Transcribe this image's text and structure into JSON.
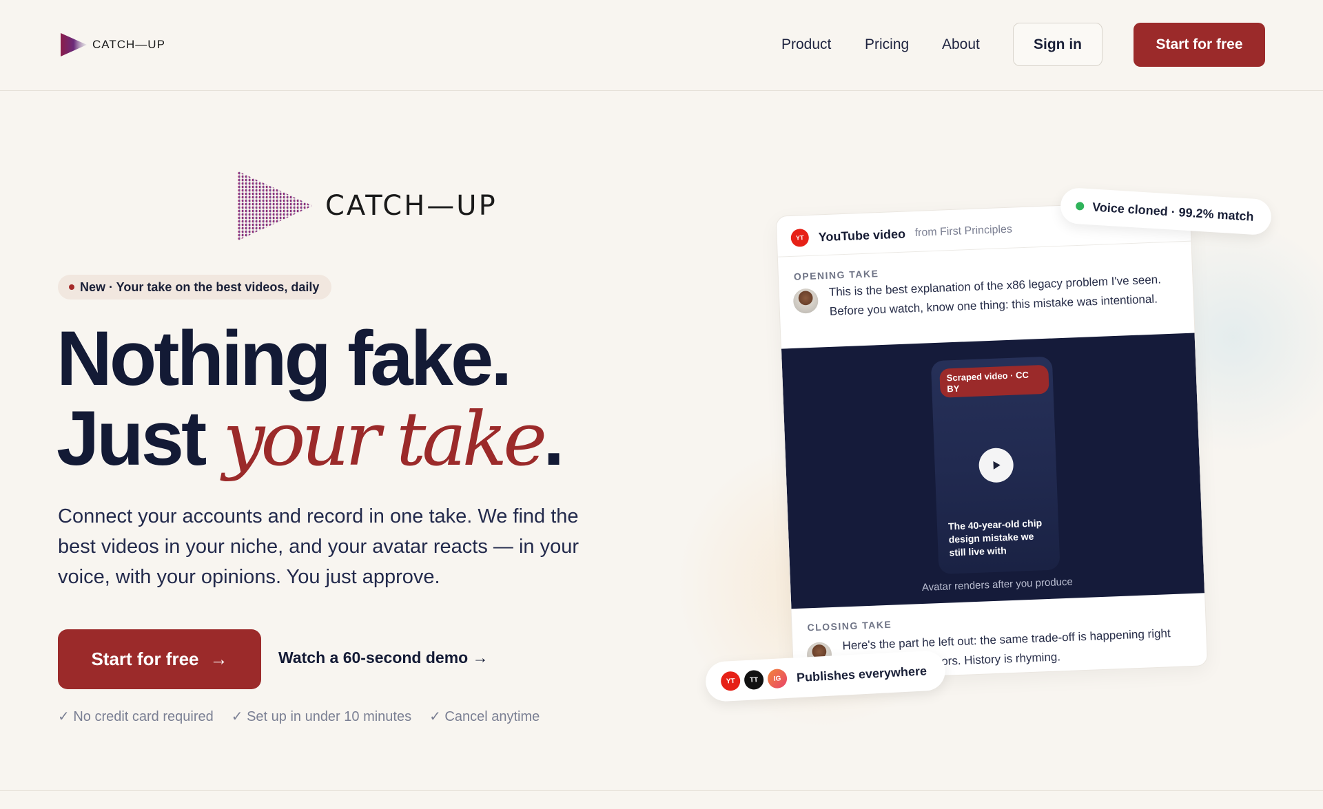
{
  "nav": {
    "brand": "CATCH—UP",
    "links": [
      "Product",
      "Pricing",
      "About"
    ],
    "signin_label": "Sign in",
    "start_label": "Start for free"
  },
  "hero": {
    "brand": "CATCH—UP",
    "pill_text": "New · Your take on the best videos, daily",
    "headline_line1": "Nothing fake.",
    "headline_just": "Just ",
    "headline_accent": "your take",
    "headline_end": ".",
    "subtitle": "Connect your accounts and record in one take. We find the best videos in your niche, and your avatar reacts — in your voice, with your opinions. You just approve.",
    "cta_label": "Start for free",
    "cta_arrow": "→",
    "demo_label": "Watch a 60-second demo →",
    "checks": [
      "✓ No credit card required",
      "✓ Set up in under 10 minutes",
      "✓ Cancel anytime"
    ]
  },
  "card": {
    "source_badge": "YT",
    "title": "YouTube video",
    "from": "from First Principles",
    "opening_label": "OPENING TAKE",
    "opening_text": "This is the best explanation of the x86 legacy problem I've seen. Before you watch, know one thing: this mistake was intentional.",
    "scraped_label": "Scraped video · CC BY",
    "video_caption": "The 40-year-old chip design mistake we still live with",
    "video_footer": "Avatar renders after you produce",
    "closing_label": "CLOSING TAKE",
    "closing_text": "Here's the part he left out: the same trade-off is happening right now in AI accelerators. History is rhyming."
  },
  "voice_chip": {
    "text": "Voice cloned · 99.2% match",
    "status_color": "#2fb35a"
  },
  "publish_chip": {
    "platforms": [
      "YT",
      "TT",
      "IG"
    ],
    "text": "Publishes everywhere"
  },
  "colors": {
    "accent": "#9b2a2a",
    "ink": "#131a35",
    "background": "#f8f5f0"
  },
  "icons": [
    "play-triangle-logo",
    "play-icon",
    "arrow-right-icon",
    "status-dot-icon"
  ]
}
